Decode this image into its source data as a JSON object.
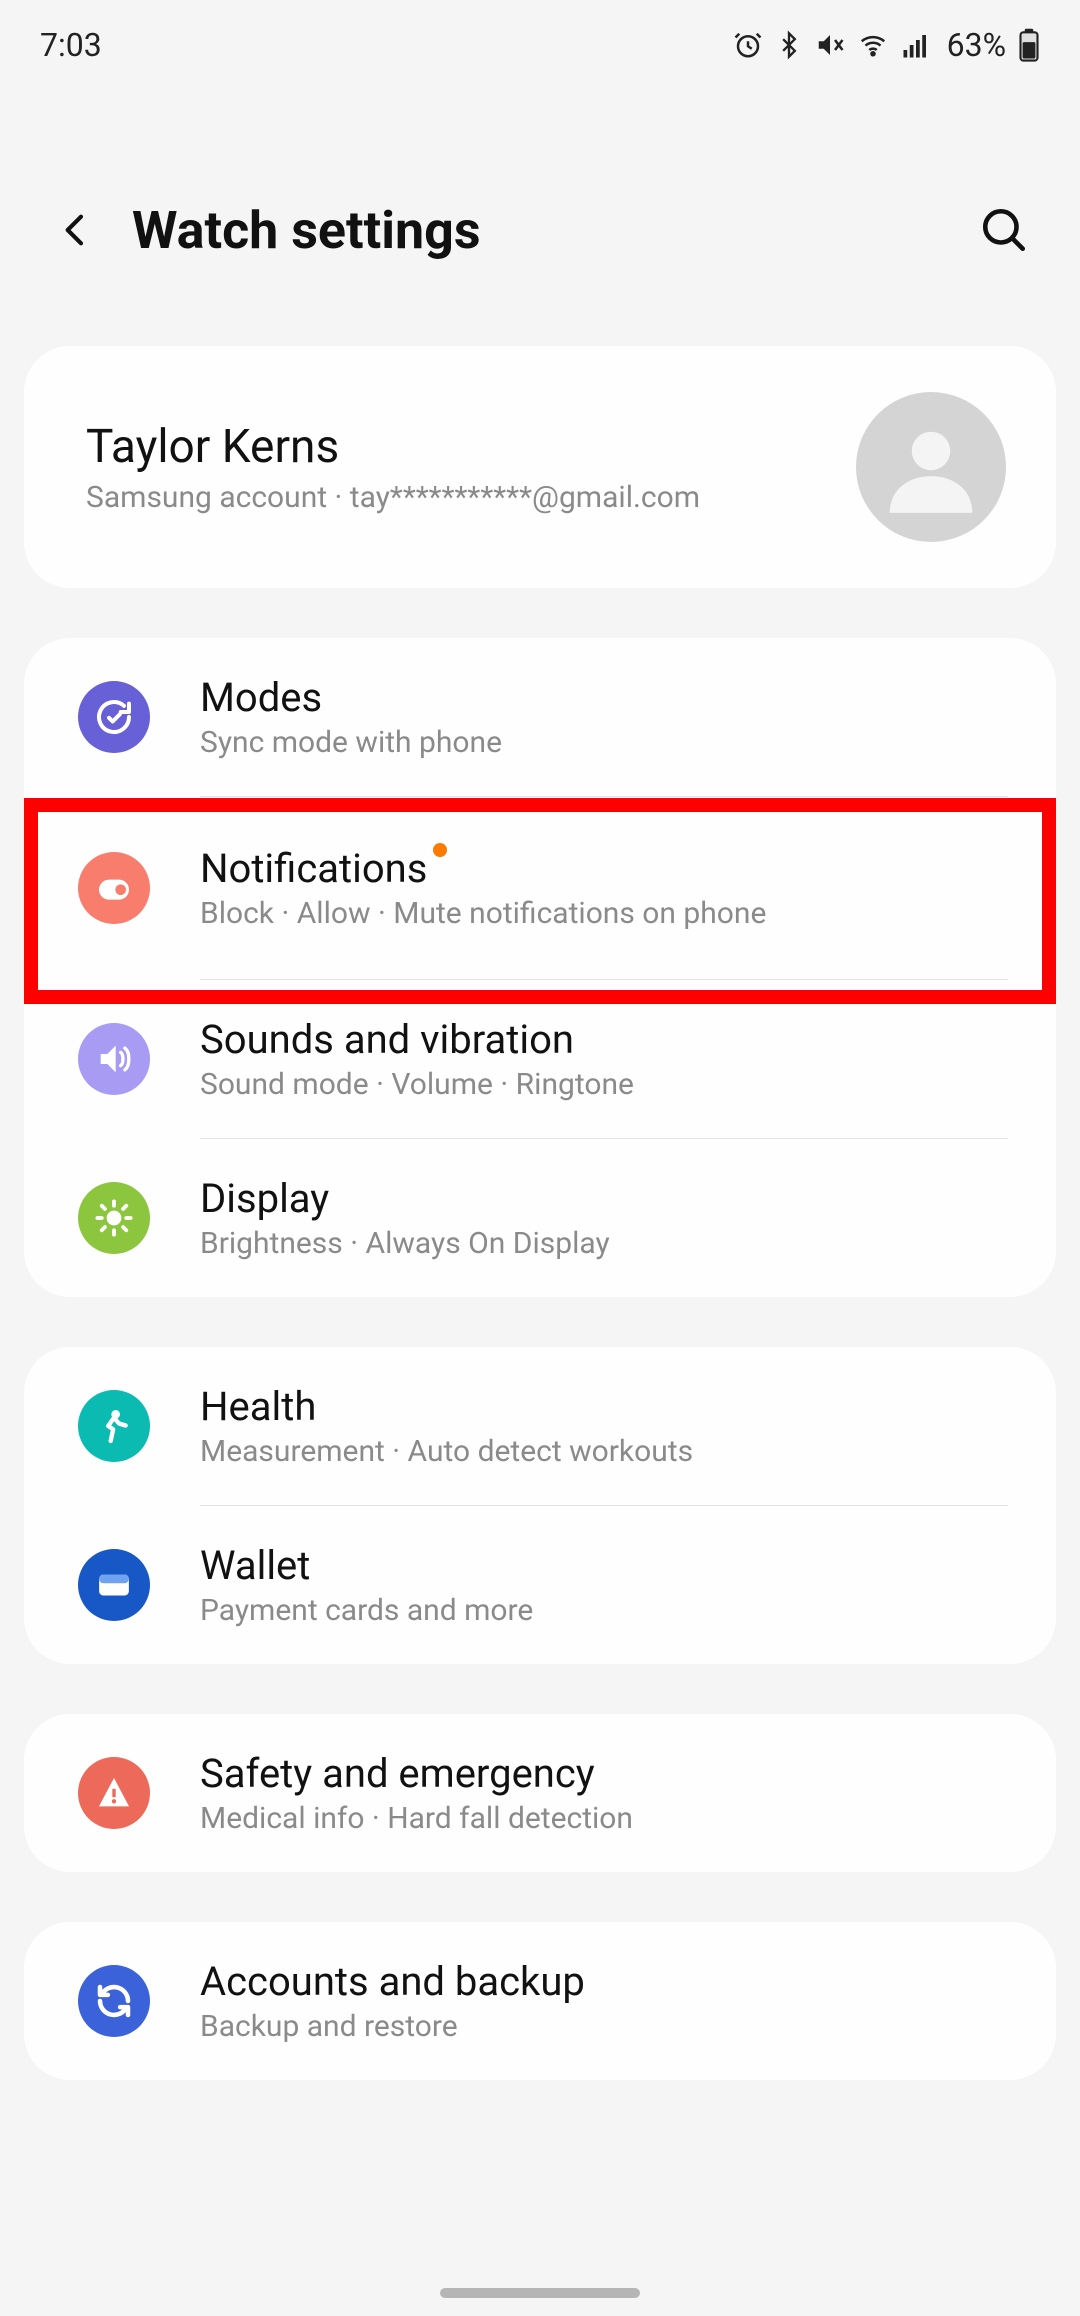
{
  "status": {
    "time": "7:03",
    "battery": "63%"
  },
  "header": {
    "title": "Watch settings"
  },
  "account": {
    "name": "Taylor Kerns",
    "subtitle": "Samsung account · tay***********@gmail.com"
  },
  "groups": {
    "g1": {
      "modes": {
        "title": "Modes",
        "sub": "Sync mode with phone",
        "color": "#6760d6"
      },
      "notifications": {
        "title": "Notifications",
        "sub": "Block · Allow · Mute notifications on phone",
        "color": "#f87d6d",
        "has_badge": true
      },
      "sounds": {
        "title": "Sounds and vibration",
        "sub": "Sound mode · Volume · Ringtone",
        "color": "#a79bf4"
      },
      "display": {
        "title": "Display",
        "sub": "Brightness · Always On Display",
        "color": "#8cc63f"
      }
    },
    "g2": {
      "health": {
        "title": "Health",
        "sub": "Measurement · Auto detect workouts",
        "color": "#0bbab0"
      },
      "wallet": {
        "title": "Wallet",
        "sub": "Payment cards and more",
        "color": "#1858c6"
      }
    },
    "g3": {
      "safety": {
        "title": "Safety and emergency",
        "sub": "Medical info · Hard fall detection",
        "color": "#ed6a5a"
      }
    },
    "g4": {
      "accounts": {
        "title": "Accounts and backup",
        "sub": "Backup and restore",
        "color": "#3b62d8"
      }
    }
  }
}
